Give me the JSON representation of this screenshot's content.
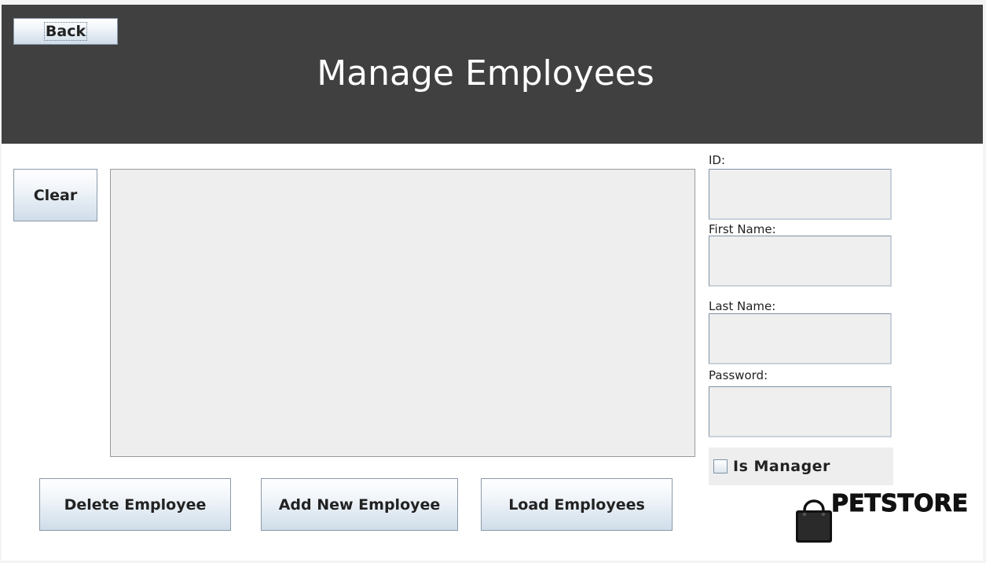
{
  "header": {
    "title": "Manage Employees",
    "back_label": "Back"
  },
  "actions": {
    "clear_label": "Clear",
    "delete_label": "Delete Employee",
    "add_label": "Add New Employee",
    "load_label": "Load Employees"
  },
  "form": {
    "id_label": "ID:",
    "id_value": "",
    "first_name_label": "First Name:",
    "first_name_value": "",
    "last_name_label": "Last Name:",
    "last_name_value": "",
    "password_label": "Password:",
    "password_value": "",
    "is_manager_label": "Is Manager",
    "is_manager_checked": false
  },
  "employee_list": {
    "items": []
  },
  "brand": {
    "logo_text": "PETSTORE",
    "icon": "shopping-bag-icon"
  },
  "colors": {
    "header_bg": "#404040",
    "header_text": "#ffffff",
    "list_bg": "#eeeeee"
  }
}
